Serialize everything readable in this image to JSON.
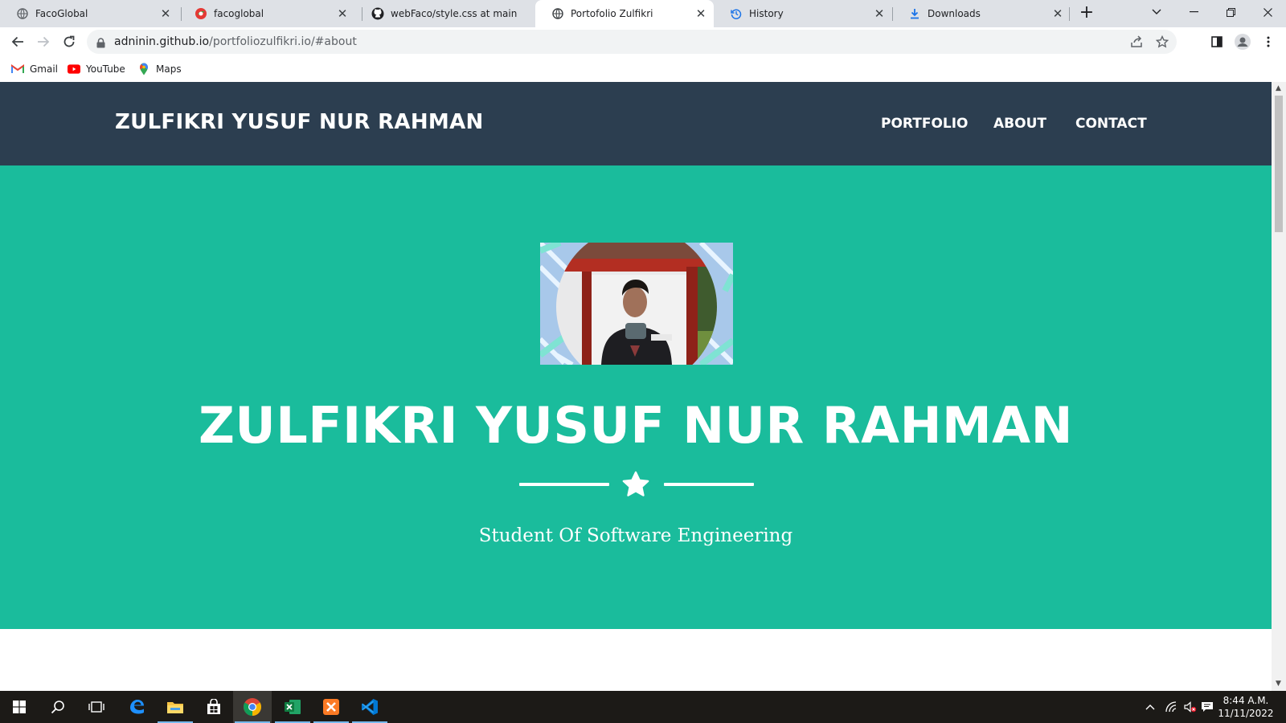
{
  "browser": {
    "tabs": [
      {
        "title": "FacoGlobal",
        "icon": "globe-icon"
      },
      {
        "title": "facoglobal",
        "icon": "site-favicon"
      },
      {
        "title": "webFaco/style.css at main · zl",
        "icon": "github-icon"
      },
      {
        "title": "Portofolio Zulfikri",
        "icon": "globe-icon",
        "active": true
      },
      {
        "title": "History",
        "icon": "history-icon"
      },
      {
        "title": "Downloads",
        "icon": "download-icon"
      }
    ],
    "url_host": "adninin.github.io",
    "url_path": "/portfoliozulfikri.io/#about",
    "bookmarks": [
      {
        "label": "Gmail",
        "icon": "gmail-icon"
      },
      {
        "label": "YouTube",
        "icon": "youtube-icon"
      },
      {
        "label": "Maps",
        "icon": "maps-icon"
      }
    ]
  },
  "site": {
    "brand": "ZULFIKRI YUSUF NUR RAHMAN",
    "nav": [
      "PORTFOLIO",
      "ABOUT",
      "CONTACT"
    ],
    "hero_title": "ZULFIKRI YUSUF NUR RAHMAN",
    "hero_subtitle": "Student Of Software Engineering",
    "colors": {
      "nav_bg": "#2c3e50",
      "hero_bg": "#1abc9c"
    }
  },
  "taskbar": {
    "apps": [
      "windows-start",
      "search",
      "task-view",
      "edge",
      "file-explorer",
      "store",
      "chrome",
      "excel",
      "xampp",
      "vscode"
    ],
    "time": "8:44 A.M.",
    "date": "11/11/2022"
  }
}
